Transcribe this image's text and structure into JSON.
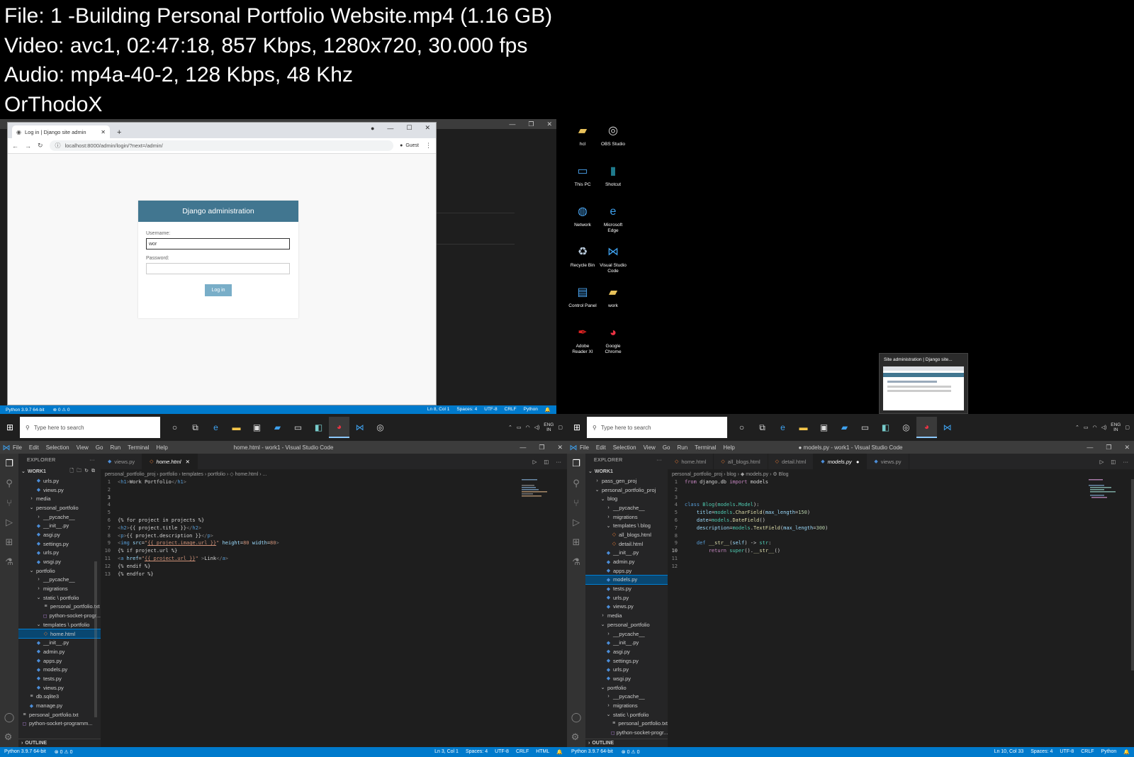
{
  "info": {
    "file": "File: 1 -Building Personal Portfolio Website.mp4 (1.16 GB)",
    "video": "Video: avc1, 02:47:18, 857 Kbps, 1280x720, 30.000 fps",
    "audio": "Audio: mp4a-40-2, 128 Kbps, 48 Khz",
    "tag": "OrThodoX"
  },
  "browser": {
    "tab_title": "Log in | Django site admin",
    "url": "localhost:8000/admin/login/?next=/admin/",
    "profile": "Guest",
    "login": {
      "header": "Django administration",
      "username_label": "Username:",
      "username_value": "wor",
      "password_label": "Password:",
      "submit": "Log in"
    }
  },
  "q1_status": {
    "python": "Python 3.9.7 64-bit",
    "problems": "⊗ 0 ⚠ 0",
    "right": [
      "Ln 8, Col 1",
      "Spaces: 4",
      "UTF-8",
      "CRLF",
      "Python"
    ]
  },
  "taskbar": {
    "search_placeholder": "Type here to search",
    "lang_top": "ENG",
    "lang_bottom": "IN"
  },
  "desktop": {
    "icons": [
      {
        "label": "hcl",
        "icon": "folder-user-icon"
      },
      {
        "label": "OBS Studio",
        "icon": "obs-icon"
      },
      {
        "label": "This PC",
        "icon": "monitor-icon"
      },
      {
        "label": "Shotcut",
        "icon": "shotcut-icon"
      },
      {
        "label": "Network",
        "icon": "network-icon"
      },
      {
        "label": "Microsoft Edge",
        "icon": "edge-icon"
      },
      {
        "label": "Recycle Bin",
        "icon": "recycle-bin-icon"
      },
      {
        "label": "Visual Studio Code",
        "icon": "vscode-icon"
      },
      {
        "label": "Control Panel",
        "icon": "control-panel-icon"
      },
      {
        "label": "work",
        "icon": "folder-icon"
      },
      {
        "label": "Adobe Reader XI",
        "icon": "adobe-reader-icon"
      },
      {
        "label": "Google Chrome",
        "icon": "chrome-icon"
      }
    ],
    "preview_title": "Site administration | Django site..."
  },
  "vscode_left": {
    "menu": [
      "File",
      "Edit",
      "Selection",
      "View",
      "Go",
      "Run",
      "Terminal",
      "Help"
    ],
    "title": "home.html - work1 - Visual Studio Code",
    "explorer_header": "EXPLORER",
    "root": "WORK1",
    "tree": [
      {
        "label": "urls.py",
        "indent": 2,
        "icon": "◆"
      },
      {
        "label": "views.py",
        "indent": 2,
        "icon": "◆"
      },
      {
        "label": "media",
        "indent": 1,
        "icon": "›"
      },
      {
        "label": "personal_portfolio",
        "indent": 1,
        "icon": "⌄"
      },
      {
        "label": "__pycache__",
        "indent": 2,
        "icon": "›"
      },
      {
        "label": "__init__.py",
        "indent": 2,
        "icon": "◆"
      },
      {
        "label": "asgi.py",
        "indent": 2,
        "icon": "◆"
      },
      {
        "label": "settings.py",
        "indent": 2,
        "icon": "◆"
      },
      {
        "label": "urls.py",
        "indent": 2,
        "icon": "◆"
      },
      {
        "label": "wsgi.py",
        "indent": 2,
        "icon": "◆"
      },
      {
        "label": "portfolio",
        "indent": 1,
        "icon": "⌄"
      },
      {
        "label": "__pycache__",
        "indent": 2,
        "icon": "›"
      },
      {
        "label": "migrations",
        "indent": 2,
        "icon": "›"
      },
      {
        "label": "static \\ portfolio",
        "indent": 2,
        "icon": "⌄"
      },
      {
        "label": "personal_portfolio.txt",
        "indent": 3,
        "icon": "≡"
      },
      {
        "label": "python-socket-progr...",
        "indent": 3,
        "icon": "◻"
      },
      {
        "label": "templates \\ portfolio",
        "indent": 2,
        "icon": "⌄"
      },
      {
        "label": "home.html",
        "indent": 3,
        "icon": "◇",
        "selected": true
      },
      {
        "label": "__init__.py",
        "indent": 2,
        "icon": "◆"
      },
      {
        "label": "admin.py",
        "indent": 2,
        "icon": "◆"
      },
      {
        "label": "apps.py",
        "indent": 2,
        "icon": "◆"
      },
      {
        "label": "models.py",
        "indent": 2,
        "icon": "◆"
      },
      {
        "label": "tests.py",
        "indent": 2,
        "icon": "◆"
      },
      {
        "label": "views.py",
        "indent": 2,
        "icon": "◆"
      },
      {
        "label": "db.sqlite3",
        "indent": 1,
        "icon": "≡"
      },
      {
        "label": "manage.py",
        "indent": 1,
        "icon": "◆"
      },
      {
        "label": "personal_portfolio.txt",
        "indent": 0,
        "icon": "≡"
      },
      {
        "label": "python-socket-programm...",
        "indent": 0,
        "icon": "◻"
      }
    ],
    "outline": "OUTLINE",
    "tabs": [
      {
        "label": "views.py",
        "icon": "◆",
        "active": false
      },
      {
        "label": "home.html",
        "icon": "◇",
        "active": true,
        "close": "✕"
      }
    ],
    "breadcrumb": "personal_portfolio_proj  ›  portfolio  ›  templates  ›  portfolio  ›  ◇ home.html  ›  ...",
    "status": {
      "python": "Python 3.9.7 64-bit",
      "problems": "⊗ 0 ⚠ 0",
      "right": [
        "Ln 3, Col 1",
        "Spaces: 4",
        "UTF-8",
        "CRLF",
        "HTML"
      ]
    }
  },
  "vscode_right": {
    "menu": [
      "File",
      "Edit",
      "Selection",
      "View",
      "Go",
      "Run",
      "Terminal",
      "Help"
    ],
    "title": "● models.py - work1 - Visual Studio Code",
    "explorer_header": "EXPLORER",
    "root": "WORK1",
    "tree": [
      {
        "label": "pass_gen_proj",
        "indent": 1,
        "icon": "›"
      },
      {
        "label": "personal_portfolio_proj",
        "indent": 1,
        "icon": "⌄"
      },
      {
        "label": "blog",
        "indent": 2,
        "icon": "⌄"
      },
      {
        "label": "__pycache__",
        "indent": 3,
        "icon": "›"
      },
      {
        "label": "migrations",
        "indent": 3,
        "icon": "›"
      },
      {
        "label": "templates \\ blog",
        "indent": 3,
        "icon": "⌄"
      },
      {
        "label": "all_blogs.html",
        "indent": 4,
        "icon": "◇"
      },
      {
        "label": "detail.html",
        "indent": 4,
        "icon": "◇"
      },
      {
        "label": "__init__.py",
        "indent": 3,
        "icon": "◆"
      },
      {
        "label": "admin.py",
        "indent": 3,
        "icon": "◆"
      },
      {
        "label": "apps.py",
        "indent": 3,
        "icon": "◆"
      },
      {
        "label": "models.py",
        "indent": 3,
        "icon": "◆",
        "selected": true
      },
      {
        "label": "tests.py",
        "indent": 3,
        "icon": "◆"
      },
      {
        "label": "urls.py",
        "indent": 3,
        "icon": "◆"
      },
      {
        "label": "views.py",
        "indent": 3,
        "icon": "◆"
      },
      {
        "label": "media",
        "indent": 2,
        "icon": "›"
      },
      {
        "label": "personal_portfolio",
        "indent": 2,
        "icon": "⌄"
      },
      {
        "label": "__pycache__",
        "indent": 3,
        "icon": "›"
      },
      {
        "label": "__init__.py",
        "indent": 3,
        "icon": "◆"
      },
      {
        "label": "asgi.py",
        "indent": 3,
        "icon": "◆"
      },
      {
        "label": "settings.py",
        "indent": 3,
        "icon": "◆"
      },
      {
        "label": "urls.py",
        "indent": 3,
        "icon": "◆"
      },
      {
        "label": "wsgi.py",
        "indent": 3,
        "icon": "◆"
      },
      {
        "label": "portfolio",
        "indent": 2,
        "icon": "⌄"
      },
      {
        "label": "__pycache__",
        "indent": 3,
        "icon": "›"
      },
      {
        "label": "migrations",
        "indent": 3,
        "icon": "›"
      },
      {
        "label": "static \\ portfolio",
        "indent": 3,
        "icon": "⌄"
      },
      {
        "label": "personal_portfolio.txt",
        "indent": 4,
        "icon": "≡"
      },
      {
        "label": "python-socket-progr...",
        "indent": 4,
        "icon": "◻"
      }
    ],
    "outline": "OUTLINE",
    "tabs": [
      {
        "label": "home.html",
        "icon": "◇",
        "active": false
      },
      {
        "label": "all_blogs.html",
        "icon": "◇",
        "active": false
      },
      {
        "label": "detail.html",
        "icon": "◇",
        "active": false
      },
      {
        "label": "models.py",
        "icon": "◆",
        "active": true,
        "close": "●"
      },
      {
        "label": "views.py",
        "icon": "◆",
        "active": false
      }
    ],
    "breadcrumb": "personal_portfolio_proj  ›  blog  ›  ◆ models.py  ›  ⚙ Blog",
    "status": {
      "python": "Python 3.9.7 64-bit",
      "problems": "⊗ 0 ⚠ 0",
      "right": [
        "Ln 10, Col 33",
        "Spaces: 4",
        "UTF-8",
        "CRLF",
        "Python"
      ]
    }
  },
  "colors": {
    "vscode_blue": "#007acc",
    "django_header": "#417690",
    "django_button": "#79aec8"
  }
}
